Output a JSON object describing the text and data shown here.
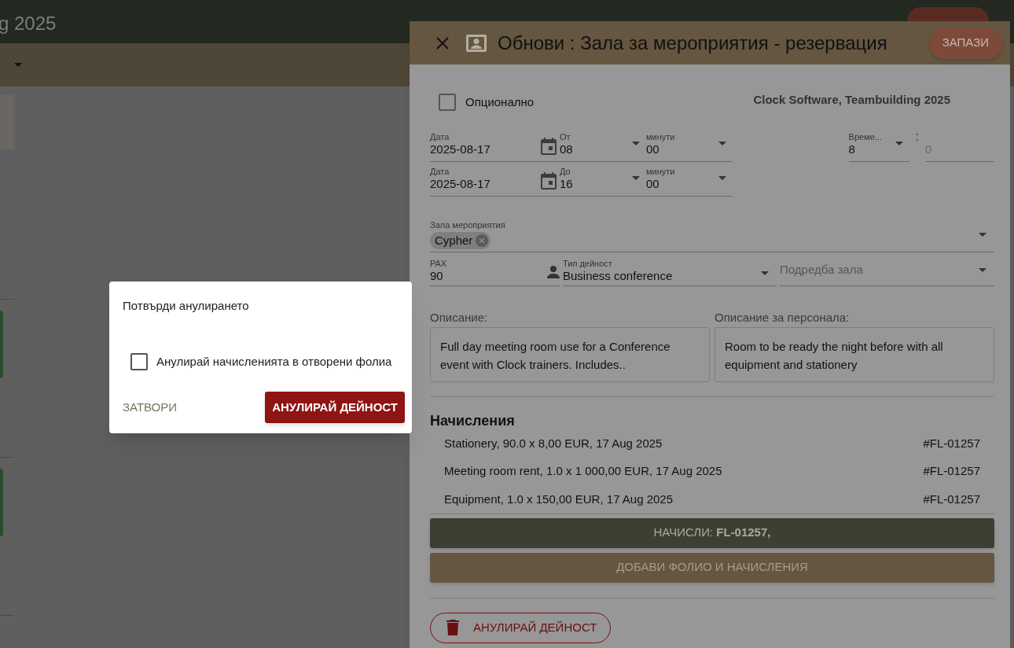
{
  "background_page": {
    "title": "g 2025"
  },
  "drawer": {
    "title": "Обнови : Зала за мероприятия - резервация",
    "save_button": "ЗАПАЗИ",
    "optional": {
      "label": "Опционално",
      "checked": false
    },
    "client": "Clock Software, Teambuilding 2025",
    "time_rows": [
      {
        "date_label": "Дата",
        "date": "2025-08-17",
        "hour_label": "От",
        "hour": "08",
        "minutes_label": "минути",
        "minutes": "00"
      },
      {
        "date_label": "Дата",
        "date": "2025-08-17",
        "hour_label": "До",
        "hour": "16",
        "minutes_label": "минути",
        "minutes": "00"
      }
    ],
    "duration": {
      "label": "Време...",
      "hours": "8",
      "separator": ":",
      "minutes": "0"
    },
    "hall": {
      "label": "Зала мероприятия",
      "chips": [
        "Cypher"
      ]
    },
    "pax": {
      "label": "PAX",
      "value": "90"
    },
    "activity_type": {
      "label": "Тип дейност",
      "value": "Business conference"
    },
    "setup": {
      "placeholder": "Подредба зала"
    },
    "description": {
      "label": "Описание:",
      "text": "Full day meeting room use for a Conference event with Clock trainers. Includes.."
    },
    "staff_description": {
      "label": "Описание за персонала:",
      "text": "Room to be ready the night before with all equipment and stationery"
    },
    "charges": {
      "title": "Начисления",
      "items": [
        {
          "text": "Stationery, 90.0 x 8,00 EUR, 17 Aug 2025",
          "folio": "#FL-01257"
        },
        {
          "text": "Meeting room rent, 1.0 x 1 000,00 EUR, 17 Aug 2025",
          "folio": "#FL-01257"
        },
        {
          "text": "Equipment, 1.0 x 150,00 EUR, 17 Aug 2025",
          "folio": "#FL-01257"
        }
      ]
    },
    "charge_button": "НАЧИСЛИ: **FL-01257,**",
    "add_folio_button": "ДОБАВИ ФОЛИО И НАЧИСЛЕНИЯ",
    "cancel_button": "АНУЛИРАЙ ДЕЙНОСТ"
  },
  "dialog": {
    "title": "Потвърди анулирането",
    "checkbox": {
      "label": "Анулирай начисленията в отворени фолиа",
      "checked": false
    },
    "close_button": "ЗАТВОРИ",
    "confirm_button": "АНУЛИРАЙ ДЕЙНОСТ"
  }
}
